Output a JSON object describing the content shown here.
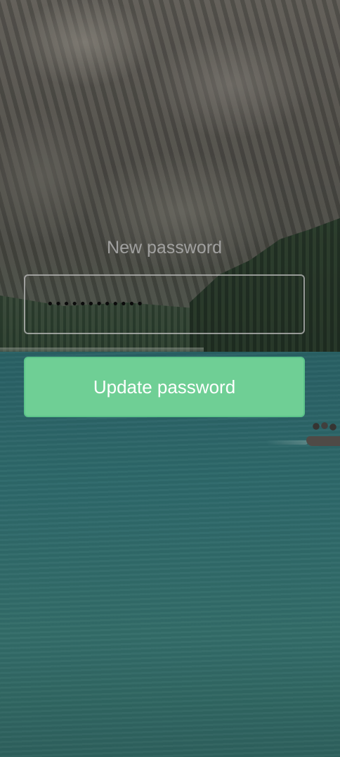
{
  "form": {
    "new_password_label": "New password",
    "password_value": "••••••••••••",
    "submit_label": "Update password"
  },
  "colors": {
    "button_background": "#6fcf95",
    "button_text": "#ffffff",
    "label_text": "#afafaf"
  }
}
